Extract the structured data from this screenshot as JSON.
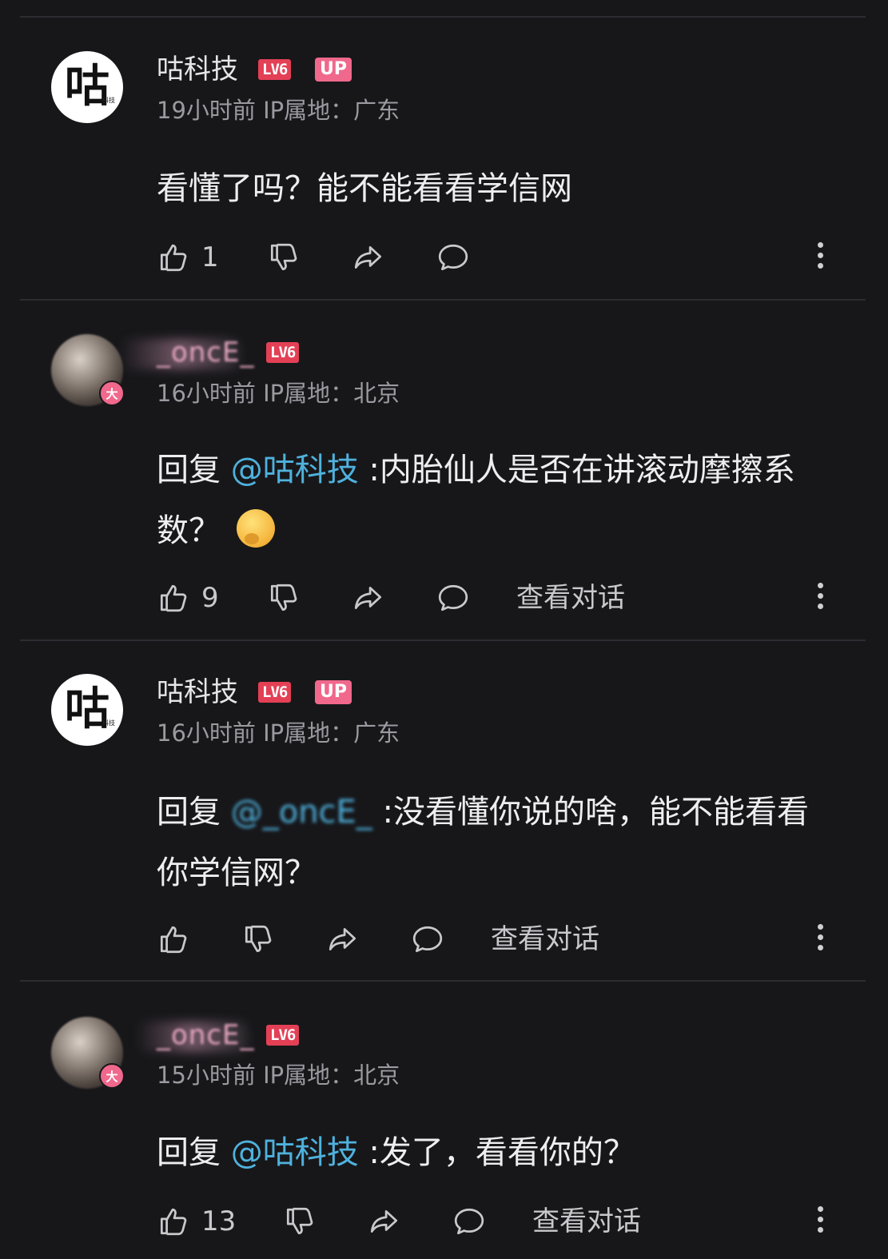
{
  "comments": [
    {
      "username": "咕科技",
      "level": "LV6",
      "up_badge": "UP",
      "avatar_glyph": "咕",
      "avatar_small": "科技",
      "meta": "19小时前 IP属地：广东",
      "body_text": "看懂了吗？能不能看看学信网",
      "likes": "1",
      "view_conversation": ""
    },
    {
      "username": "_oncE_",
      "level": "LV6",
      "avatar_badge": "大",
      "meta": "16小时前 IP属地：北京",
      "reply_prefix": "回复 ",
      "mention": "@咕科技",
      "body_text": " :内胎仙人是否在讲滚动摩擦系数？",
      "likes": "9",
      "view_conversation": "查看对话"
    },
    {
      "username": "咕科技",
      "level": "LV6",
      "up_badge": "UP",
      "avatar_glyph": "咕",
      "avatar_small": "科技",
      "meta": "16小时前 IP属地：广东",
      "reply_prefix": "回复 ",
      "mention": "@_oncE_",
      "body_text": " :没看懂你说的啥，能不能看看你学信网？",
      "likes": "",
      "view_conversation": "查看对话"
    },
    {
      "username": "_oncE_",
      "level": "LV6",
      "avatar_badge": "大",
      "meta": "15小时前 IP属地：北京",
      "reply_prefix": "回复 ",
      "mention": "@咕科技",
      "body_text": " :发了，看看你的？",
      "likes": "13",
      "view_conversation": "查看对话"
    }
  ],
  "icons": [
    "thumbs-up-icon",
    "thumbs-down-icon",
    "share-icon",
    "reply-icon",
    "more-icon"
  ],
  "colors": {
    "background": "#17171a",
    "mention": "#4fb2dd",
    "level_badge": "#e34056",
    "up_badge": "#f0688c"
  }
}
